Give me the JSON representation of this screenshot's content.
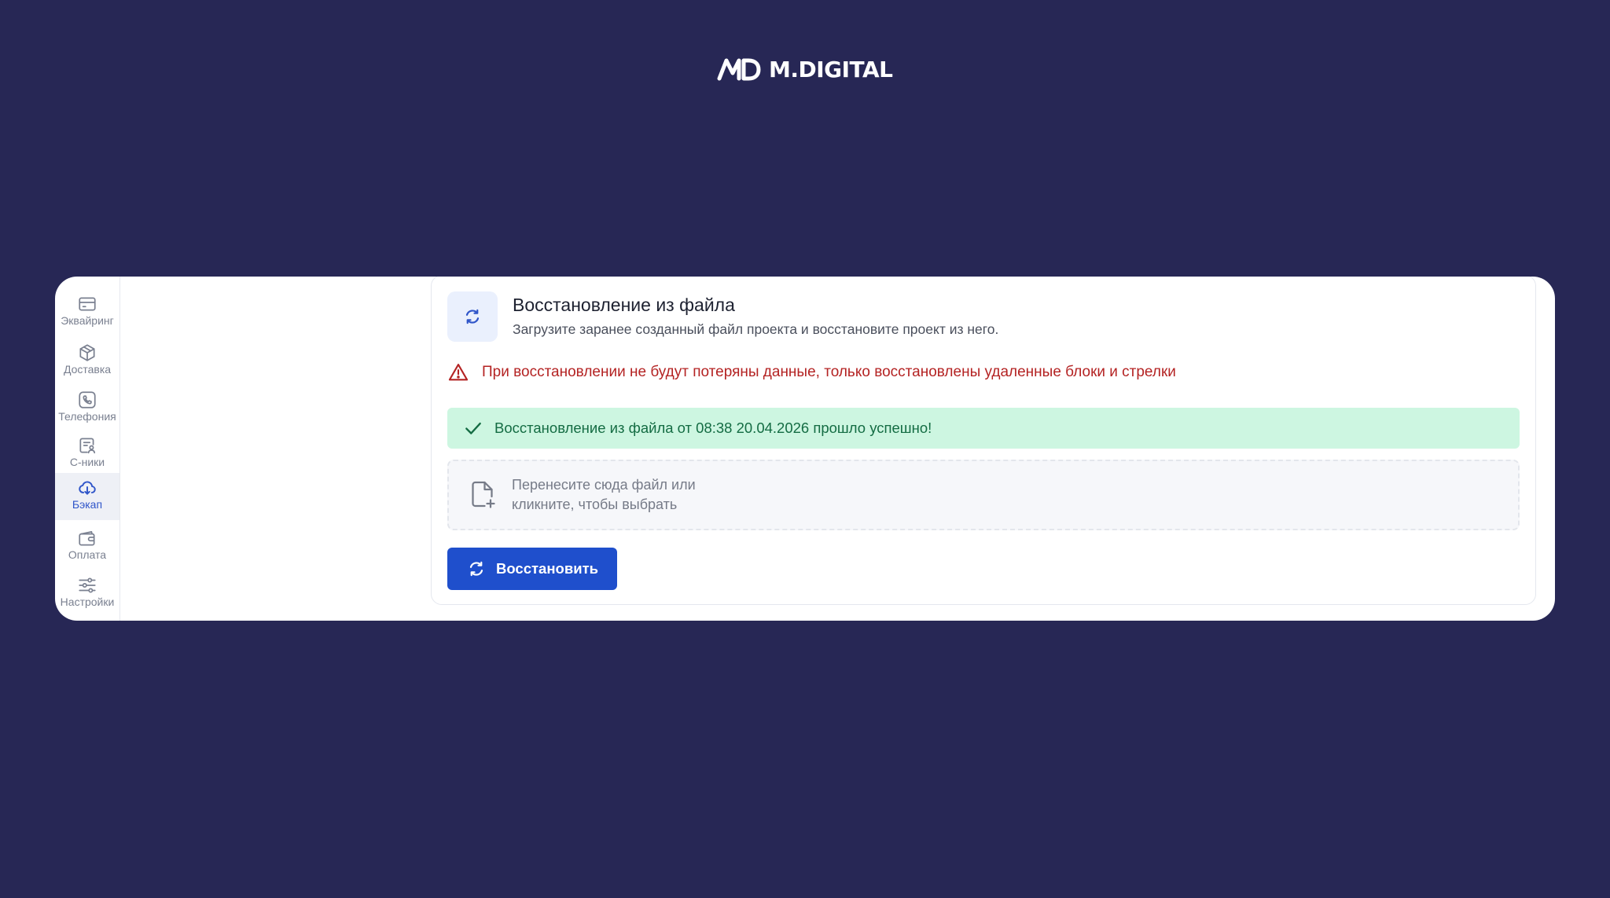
{
  "brand": {
    "name": "M.DIGITAL",
    "logo_icon": "md-logo-icon"
  },
  "sidebar": {
    "items": [
      {
        "label": "Эквайринг",
        "icon": "credit-card-icon",
        "active": false
      },
      {
        "label": "Доставка",
        "icon": "box-icon",
        "active": false
      },
      {
        "label": "Телефония",
        "icon": "phone-icon",
        "active": false
      },
      {
        "label": "С-ники",
        "icon": "contact-list-icon",
        "active": false
      },
      {
        "label": "Бэкап",
        "icon": "cloud-backup-icon",
        "active": true
      },
      {
        "label": "Оплата",
        "icon": "wallet-icon",
        "active": false
      },
      {
        "label": "Настройки",
        "icon": "sliders-icon",
        "active": false
      }
    ]
  },
  "restore": {
    "icon": "refresh-icon",
    "title": "Восстановление из файла",
    "subtitle": "Загрузите заранее созданный файл проекта и восстановите проект из него.",
    "warning": "При восстановлении не будут потеряны данные, только восстановлены удаленные блоки и стрелки",
    "success": "Восстановление из файла от 08:38 20.04.2026 прошло успешно!",
    "dropzone": {
      "line1": "Перенесите сюда файл или",
      "line2": "кликните, чтобы выбрать"
    },
    "button_label": "Восстановить"
  },
  "colors": {
    "background": "#272755",
    "accent": "#1f4fcc",
    "warning": "#b42323",
    "success_bg": "#cdf6e1",
    "success_text": "#146c43"
  }
}
